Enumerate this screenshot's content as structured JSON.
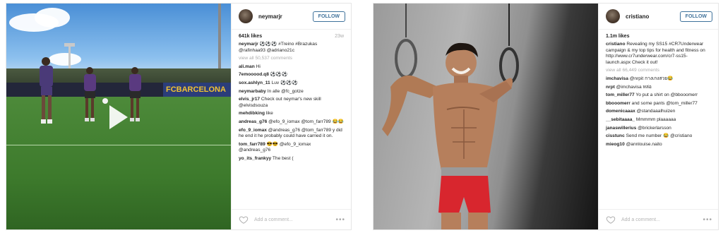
{
  "post1": {
    "username": "neymarjr",
    "follow_label": "FOLLOW",
    "likes": "641k likes",
    "age": "23w",
    "caption": {
      "user": "neymarjr",
      "text": "⚽⚽⚽ #Treino #Brazukas @rafinhaa93 @adriano21c"
    },
    "view_all": "view all 50,537 comments",
    "comments": [
      {
        "user": "ali.man",
        "text": "Hi"
      },
      {
        "user": "7emooood.q8",
        "text": "⚽⚽⚽"
      },
      {
        "user": "sox.ashlyn_11",
        "text": "Luv ⚽⚽⚽"
      },
      {
        "user": "neymarbaby",
        "text": "In alle @fc_gotze"
      },
      {
        "user": "elvis_jr17",
        "text": "Check out neymar's new skill @elvisdsouza"
      },
      {
        "user": "mehdibking",
        "text": "like"
      },
      {
        "user": "andreas_g76",
        "text": "@efo_9_iomax @tom_farr789 😂😂"
      },
      {
        "user": "efo_9_iomax",
        "text": "@andreas_g76 @tom_farr789 y did he end it he probably could have carried it on."
      },
      {
        "user": "tom_farr789",
        "text": "😎😎 @efo_9_iomax @andreas_g76"
      },
      {
        "user": "yo_its_frankyy",
        "text": "The best ("
      }
    ],
    "add_comment_placeholder": "Add a comment...",
    "more_label": "•••",
    "banner_text": "FCBARCELONA"
  },
  "post2": {
    "username": "cristiano",
    "follow_label": "FOLLOW",
    "likes": "1.1m likes",
    "age": "",
    "caption": {
      "user": "cristiano",
      "text": "Revealing my SS15 #CR7Underwear campaign & my top tips for health and fitness on http://www.cr7underwear.com/cr7-ss15-launch.aspx Check it out!"
    },
    "view_all": "view all 66,449 comments",
    "comments": [
      {
        "user": "imchavisa",
        "text": "@nrpit กางเกงสวย😂"
      },
      {
        "user": "nrpt",
        "text": "@imchavisa หล่อ"
      },
      {
        "user": "tom_miller77",
        "text": "Yo put a shirt on @bbooomerr"
      },
      {
        "user": "bbooomerr",
        "text": "and some pants @tom_miller77"
      },
      {
        "user": "domenicaaax",
        "text": "@standaaalhuizen"
      },
      {
        "user": "__sebitaaaa_",
        "text": "Mmmmm plaaaaaa"
      },
      {
        "user": "janaswillerius",
        "text": "@brickerlarsson"
      },
      {
        "user": "cisstunc",
        "text": "Send me number 😂 @cristiano"
      },
      {
        "user": "mieog10",
        "text": "@annlouise.naito"
      }
    ],
    "add_comment_placeholder": "Add a comment...",
    "more_label": "•••"
  }
}
